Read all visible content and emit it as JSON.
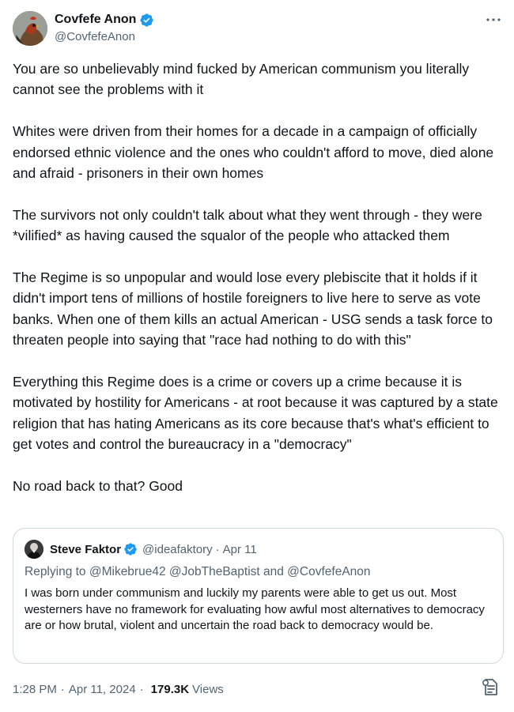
{
  "colors": {
    "text": "#0f1419",
    "secondary": "#536471",
    "verified_blue": "#1d9bf0",
    "border": "#cfd9de"
  },
  "author": {
    "display_name": "Covfefe Anon",
    "handle": "@CovfefeAnon",
    "verified": true,
    "avatar_icon": "rooster-avatar"
  },
  "more_icon": "more-horizontal-icon",
  "body": {
    "paragraphs": [
      "You are so unbelievably mind fucked by American communism you literally cannot see the problems with it",
      "Whites were driven from their homes for a decade in a campaign of officially endorsed ethnic violence and the ones who couldn't afford to move, died alone and afraid - prisoners in their own homes",
      "The survivors not only couldn't talk about what they went through - they were *vilified* as having caused the squalor of the people who attacked them",
      "The Regime is so unpopular and would lose every plebiscite that it holds if it didn't import tens of millions of hostile foreigners to live here to serve as vote banks. When one of them kills an actual American - USG sends a task force to threaten people into saying that \"race had nothing to do with this\"",
      "Everything this Regime does is a crime or covers up a crime because it is motivated by hostility for Americans - at root because it was captured by a state religion that has hating Americans as its core because that's what's efficient to get votes and control the bureaucracy in a \"democracy\"",
      "No road back to that? Good"
    ]
  },
  "quote": {
    "display_name": "Steve Faktor",
    "handle": "@ideafaktory",
    "separator": "·",
    "date": "Apr 11",
    "verified": true,
    "replying_to": "Replying to @Mikebrue42 @JobTheBaptist and @CovfefeAnon",
    "text": "I was born under communism and luckily my parents were able to get us out. Most westerners have no framework for evaluating how awful most alternatives to democracy are or how brutal, violent and uncertain the road back to democracy would be."
  },
  "meta": {
    "time": "1:28 PM",
    "date": "Apr 11, 2024",
    "separator": "·",
    "views_count": "179.3K",
    "views_label": "Views"
  },
  "footer_icon": "bookmark-analytics-icon"
}
